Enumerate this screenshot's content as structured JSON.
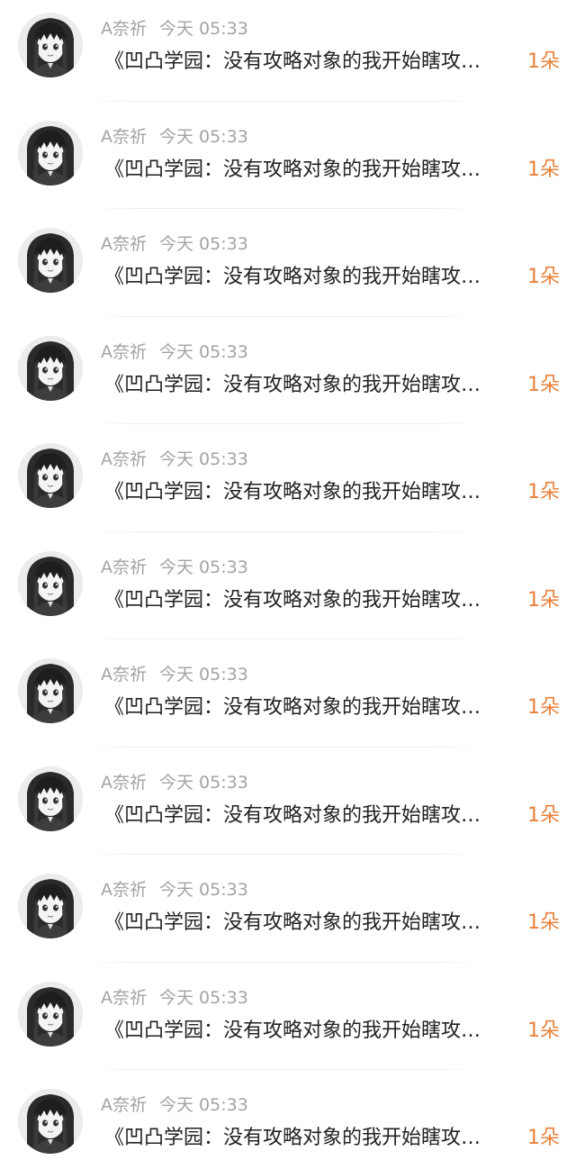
{
  "messages": [
    {
      "user": "A奈祈",
      "time": "今天 05:33",
      "text": "《凹凸学园：没有攻略对象的我开始瞎攻…",
      "gift": "1朵"
    },
    {
      "user": "A奈祈",
      "time": "今天 05:33",
      "text": "《凹凸学园：没有攻略对象的我开始瞎攻…",
      "gift": "1朵"
    },
    {
      "user": "A奈祈",
      "time": "今天 05:33",
      "text": "《凹凸学园：没有攻略对象的我开始瞎攻…",
      "gift": "1朵"
    },
    {
      "user": "A奈祈",
      "time": "今天 05:33",
      "text": "《凹凸学园：没有攻略对象的我开始瞎攻…",
      "gift": "1朵"
    },
    {
      "user": "A奈祈",
      "time": "今天 05:33",
      "text": "《凹凸学园：没有攻略对象的我开始瞎攻…",
      "gift": "1朵"
    },
    {
      "user": "A奈祈",
      "time": "今天 05:33",
      "text": "《凹凸学园：没有攻略对象的我开始瞎攻…",
      "gift": "1朵"
    },
    {
      "user": "A奈祈",
      "time": "今天 05:33",
      "text": "《凹凸学园：没有攻略对象的我开始瞎攻…",
      "gift": "1朵"
    },
    {
      "user": "A奈祈",
      "time": "今天 05:33",
      "text": "《凹凸学园：没有攻略对象的我开始瞎攻…",
      "gift": "1朵"
    },
    {
      "user": "A奈祈",
      "time": "今天 05:33",
      "text": "《凹凸学园：没有攻略对象的我开始瞎攻…",
      "gift": "1朵"
    },
    {
      "user": "A奈祈",
      "time": "今天 05:33",
      "text": "《凹凸学园：没有攻略对象的我开始瞎攻…",
      "gift": "1朵"
    },
    {
      "user": "A奈祈",
      "time": "今天 05:33",
      "text": "《凹凸学园：没有攻略对象的我开始瞎攻…",
      "gift": "1朵"
    }
  ],
  "colors": {
    "meta": "#a3a3a3",
    "text": "#222222",
    "gift": "#e8813a",
    "background": "#ffffff"
  },
  "icons": {
    "avatar": "user-avatar"
  }
}
